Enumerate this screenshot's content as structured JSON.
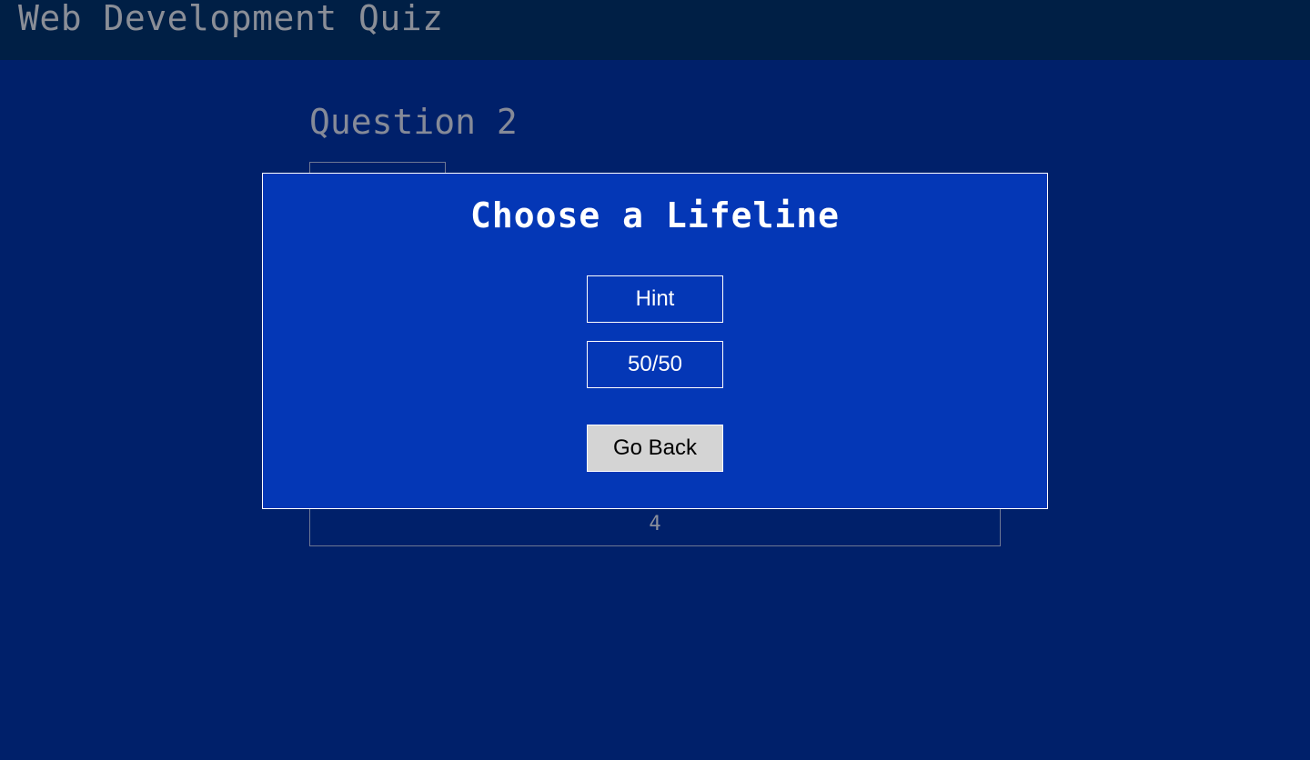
{
  "header": {
    "title": "Web Development Quiz"
  },
  "question": {
    "title": "Question 2",
    "visible_option": "4"
  },
  "modal": {
    "title": "Choose a Lifeline",
    "hint_label": "Hint",
    "fifty_fifty_label": "50/50",
    "go_back_label": "Go Back"
  },
  "colors": {
    "page_background": "#00206a",
    "header_background": "#001f45",
    "modal_background": "#0437b6",
    "button_secondary": "#d4d4d4"
  }
}
